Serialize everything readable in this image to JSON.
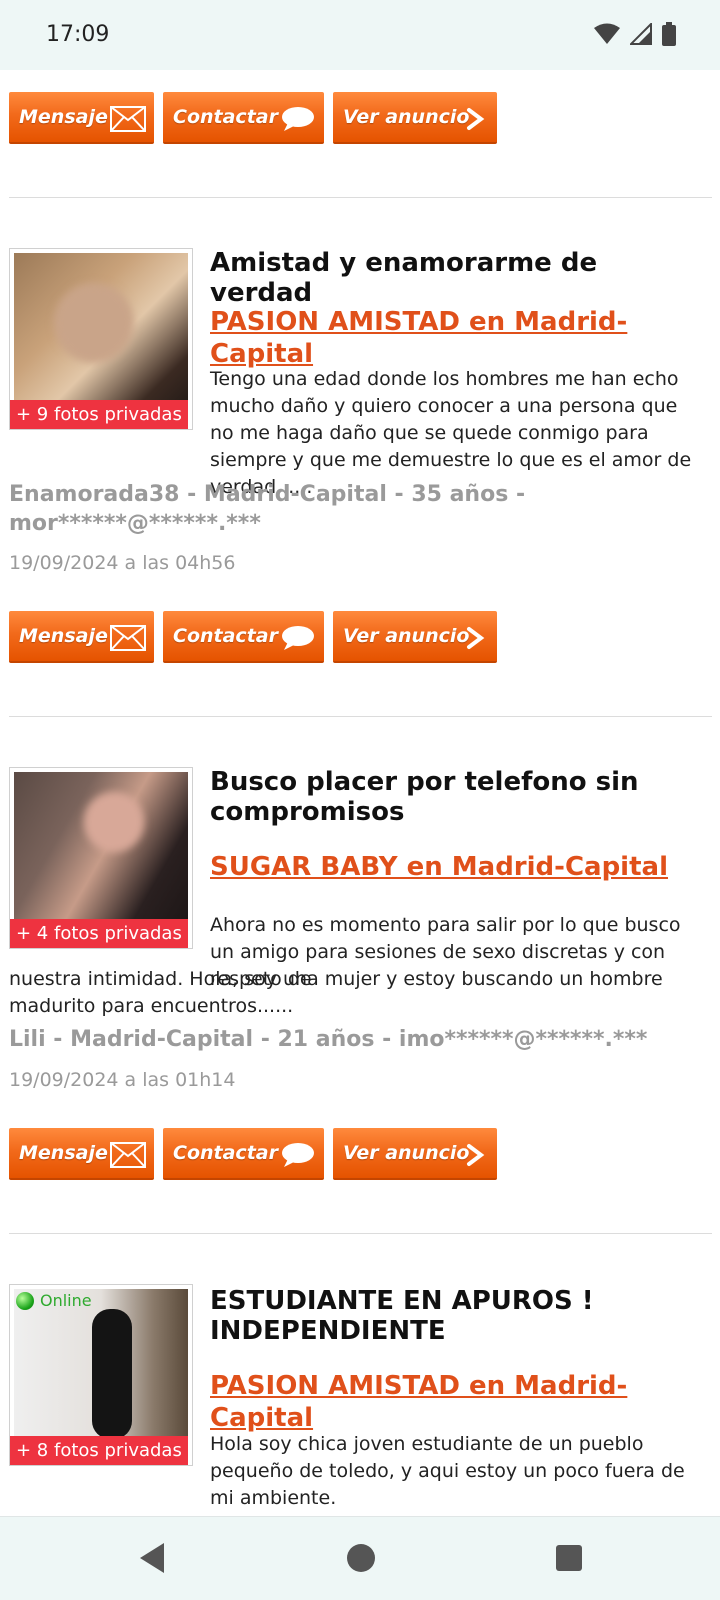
{
  "status": {
    "time": "17:09"
  },
  "buttons": {
    "message": "Mensaje",
    "contact": "Contactar",
    "view": "Ver anuncio"
  },
  "listings": [
    {
      "title": "Amistad y enamorarme de verdad",
      "category": "PASION AMISTAD en Madrid-Capital",
      "description": "Tengo una edad donde los hombres me han echo mucho daño y quiero conocer a una persona que no me haga daño que se quede conmigo para siempre y que me demuestre lo que es el amor de verdad......",
      "meta": "Enamorada38 - Madrid-Capital - 35 años - mor******@******.***",
      "date": "19/09/2024 a las 04h56",
      "fotos": "+ 9 fotos privadas"
    },
    {
      "title": "Busco placer por telefono sin compromisos",
      "category": "SUGAR BABY en Madrid-Capital",
      "description_part1": "Ahora no es momento para salir por lo que busco un amigo para sesiones de sexo discretas y con respeto de",
      "description_part2": "nuestra intimidad. Hola, soy una mujer y estoy buscando un hombre madurito para encuentros......",
      "meta": "Lili - Madrid-Capital - 21 años - imo******@******.***",
      "date": "19/09/2024 a las 01h14",
      "fotos": "+ 4 fotos privadas"
    },
    {
      "title": "ESTUDIANTE EN APUROS ! INDEPENDIENTE",
      "category": "PASION AMISTAD en Madrid-Capital",
      "description": "Hola soy chica joven estudiante de un pueblo pequeño de toledo, y aqui estoy un poco fuera de mi ambiente.",
      "online": "Online",
      "fotos": "+ 8 fotos privadas"
    }
  ]
}
